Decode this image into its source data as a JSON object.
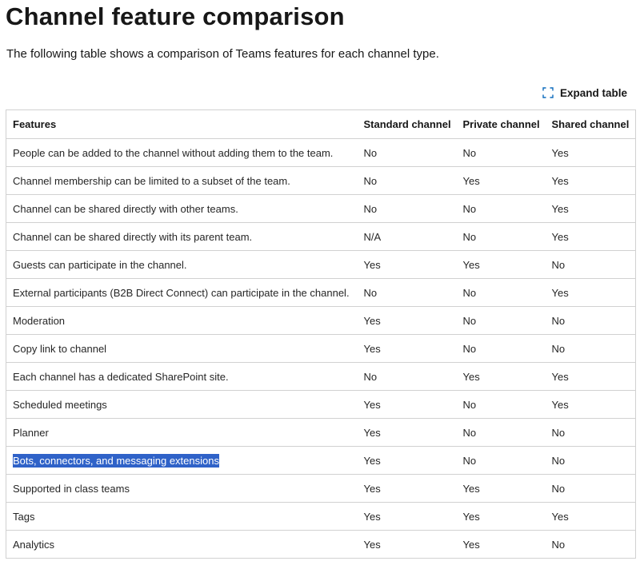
{
  "page": {
    "title": "Channel feature comparison",
    "intro": "The following table shows a comparison of Teams features for each channel type.",
    "expand_label": "Expand table"
  },
  "table": {
    "headers": [
      "Features",
      "Standard channel",
      "Private channel",
      "Shared channel"
    ],
    "rows": [
      [
        "People can be added to the channel without adding them to the team.",
        "No",
        "No",
        "Yes"
      ],
      [
        "Channel membership can be limited to a subset of the team.",
        "No",
        "Yes",
        "Yes"
      ],
      [
        "Channel can be shared directly with other teams.",
        "No",
        "No",
        "Yes"
      ],
      [
        "Channel can be shared directly with its parent team.",
        "N/A",
        "No",
        "Yes"
      ],
      [
        "Guests can participate in the channel.",
        "Yes",
        "Yes",
        "No"
      ],
      [
        "External participants (B2B Direct Connect) can participate in the channel.",
        "No",
        "No",
        "Yes"
      ],
      [
        "Moderation",
        "Yes",
        "No",
        "No"
      ],
      [
        "Copy link to channel",
        "Yes",
        "No",
        "No"
      ],
      [
        "Each channel has a dedicated SharePoint site.",
        "No",
        "Yes",
        "Yes"
      ],
      [
        "Scheduled meetings",
        "Yes",
        "No",
        "Yes"
      ],
      [
        "Planner",
        "Yes",
        "No",
        "No"
      ],
      [
        "Bots, connectors, and messaging extensions",
        "Yes",
        "No",
        "No"
      ],
      [
        "Supported in class teams",
        "Yes",
        "Yes",
        "No"
      ],
      [
        "Tags",
        "Yes",
        "Yes",
        "Yes"
      ],
      [
        "Analytics",
        "Yes",
        "Yes",
        "No"
      ]
    ]
  },
  "selection": {
    "row_index": 11,
    "color": "#2f62c8"
  },
  "icons": {
    "expand": "expand-icon"
  }
}
